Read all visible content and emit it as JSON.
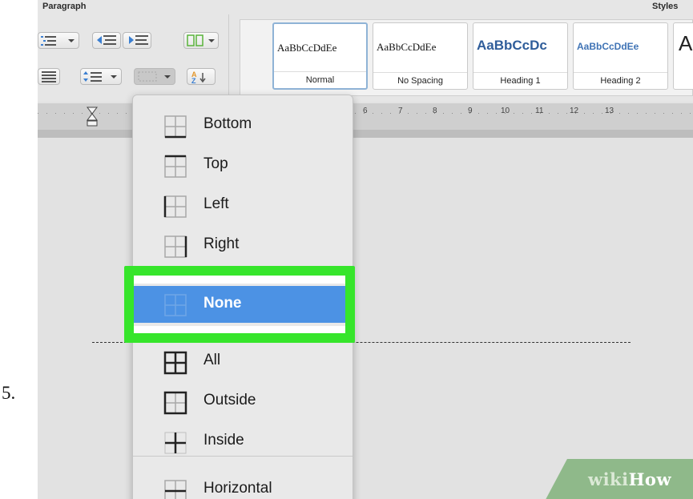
{
  "step": {
    "number": "5."
  },
  "ribbon": {
    "paragraph_label": "Paragraph",
    "styles_label": "Styles",
    "styles": [
      {
        "sample": "AaBbCcDdEe",
        "name": "Normal",
        "selected": true
      },
      {
        "sample": "AaBbCcDdEe",
        "name": "No Spacing",
        "selected": false
      },
      {
        "sample": "AaBbCcDc",
        "name": "Heading 1",
        "selected": false
      },
      {
        "sample": "AaBbCcDdEe",
        "name": "Heading 2",
        "selected": false
      },
      {
        "sample": "A",
        "name": "",
        "selected": false
      }
    ]
  },
  "ruler": {
    "numbers": [
      "6",
      "7",
      "8",
      "9",
      "10",
      "11",
      "12",
      "13"
    ]
  },
  "border_menu": {
    "items": [
      {
        "label": "Bottom",
        "icon": "border-bottom-icon"
      },
      {
        "label": "Top",
        "icon": "border-top-icon"
      },
      {
        "label": "Left",
        "icon": "border-left-icon"
      },
      {
        "label": "Right",
        "icon": "border-right-icon"
      },
      {
        "label": "None",
        "icon": "border-none-icon",
        "active": true
      },
      {
        "label": "All",
        "icon": "border-all-icon"
      },
      {
        "label": "Outside",
        "icon": "border-outside-icon"
      },
      {
        "label": "Inside",
        "icon": "border-inside-icon"
      },
      {
        "label": "Horizontal",
        "icon": "border-horizontal-icon"
      }
    ]
  },
  "watermark": {
    "part1": "wiki",
    "part2": "How"
  },
  "colors": {
    "highlight": "#36e52b",
    "menu_active": "#4c92e4"
  }
}
